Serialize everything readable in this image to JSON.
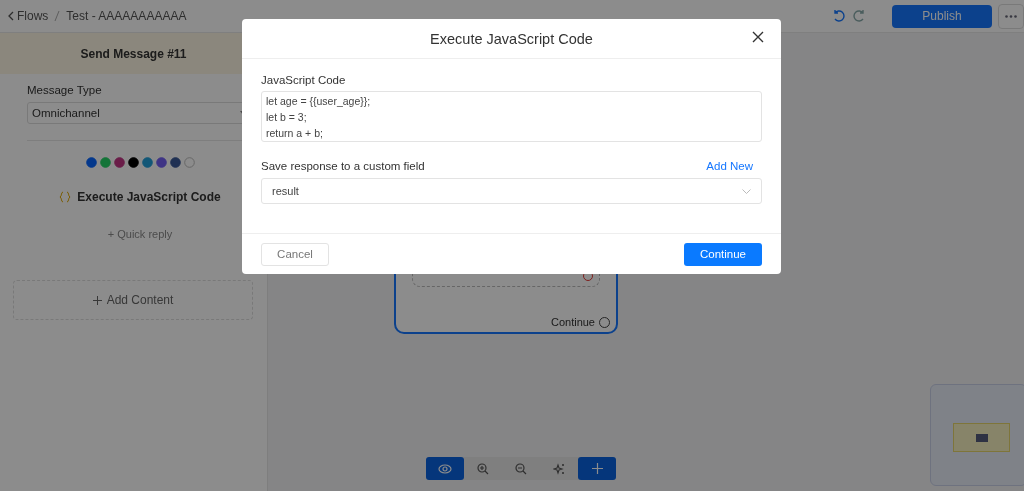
{
  "breadcrumb": {
    "back": "Flows",
    "title": "Test - AAAAAAAAAAA"
  },
  "publish_button": "Publish",
  "panel": {
    "title": "Send Message #11",
    "message_type_label": "Message Type",
    "message_type": "Omnichannel",
    "block_title": "Execute JavaScript Code",
    "quick_reply": "+ Quick reply",
    "add_content": "Add Content"
  },
  "canvas": {
    "node_output": "Continue"
  },
  "toolbar": [
    {
      "kind": "eye",
      "selected": true
    },
    {
      "kind": "zoom-in",
      "selected": false
    },
    {
      "kind": "zoom-out",
      "selected": false
    },
    {
      "kind": "fit",
      "selected": false
    },
    {
      "kind": "plus",
      "selected": true
    }
  ],
  "modal": {
    "title": "Execute JavaScript Code",
    "code_label": "JavaScript Code",
    "code_lines": [
      "let age = {{user_age}};",
      "let b = 3;",
      "return a + b;"
    ],
    "field_label": "Save response to a custom field",
    "add_new": "Add New",
    "field_value": "result",
    "cancel": "Cancel",
    "continue": "Continue"
  }
}
